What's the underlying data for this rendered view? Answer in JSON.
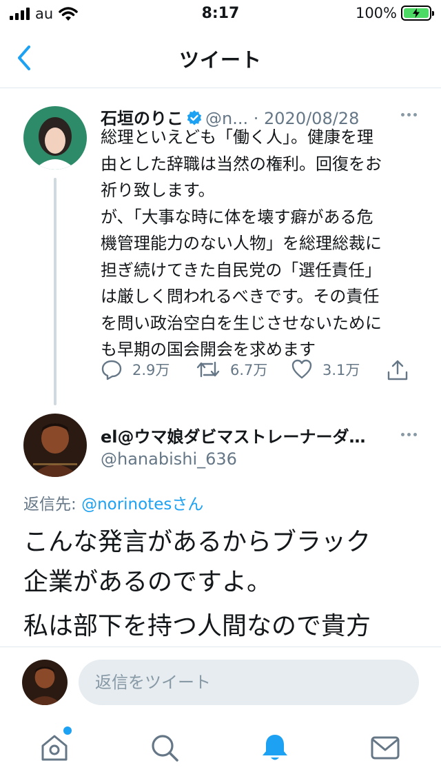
{
  "status_bar": {
    "carrier": "au",
    "time": "8:17",
    "battery": "100%",
    "battery_level": 1.0
  },
  "nav": {
    "title": "ツイート",
    "back_icon": "chevron-left-icon"
  },
  "tweet": {
    "author_name": "石垣のりこ",
    "handle": "@n...",
    "date": "· 2020/08/28",
    "verified": true,
    "lines": [
      "総理といえども「働く人」。健康を理",
      "由とした辞職は当然の権利。回復をお",
      "祈り致します。",
      "が、「大事な時に体を壊す癖がある危",
      "機管理能力のない人物」を総理総裁に",
      "担ぎ続けてきた自民党の「選任責任」",
      "は厳しく問われるべきです。その責任",
      "を問い政治空白を生じさせないために",
      "も早期の国会開会を求めます"
    ],
    "actions": {
      "replies": "2.9万",
      "retweets": "6.7万",
      "likes": "3.1万"
    }
  },
  "reply": {
    "author_name": "el@ウマ娘ダビマストレーナーダ…",
    "handle": "@hanabishi_636",
    "reply_to_label": "返信先:",
    "reply_to_mention": "@norinotesさん",
    "lines": [
      "こんな発言があるからブラック",
      "企業があるのですよ。",
      "私は部下を持つ人間なので貴方"
    ]
  },
  "composer": {
    "placeholder": "返信をツイート"
  },
  "tab_bar": {
    "items": [
      "home-icon",
      "search-icon",
      "notifications-icon",
      "messages-icon"
    ],
    "active": "notifications-icon"
  },
  "colors": {
    "accent": "#1da1f2",
    "text_primary": "#14171a",
    "text_secondary": "#657786",
    "divider": "#e1e8ed",
    "battery_green": "#4cd964"
  }
}
